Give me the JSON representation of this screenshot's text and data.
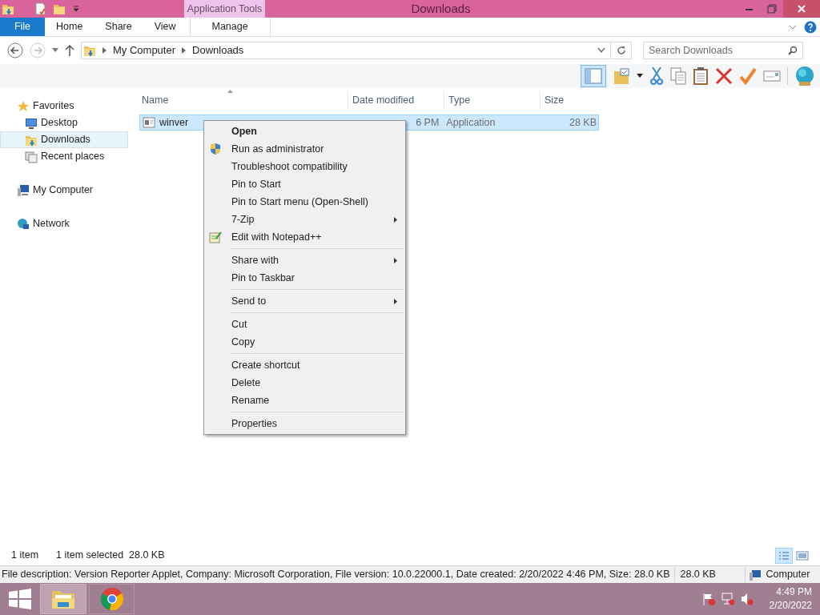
{
  "window": {
    "title": "Downloads"
  },
  "ribbon": {
    "file_tab": "File",
    "tabs": [
      "Home",
      "Share",
      "View"
    ],
    "context_group": {
      "title": "Application Tools",
      "tabs": [
        "Manage"
      ]
    }
  },
  "address_bar": {
    "path": [
      "My Computer",
      "Downloads"
    ]
  },
  "search": {
    "placeholder": "Search Downloads"
  },
  "sidebar": {
    "items": [
      {
        "label": "Favorites",
        "selected": false,
        "children": [
          {
            "label": "Desktop",
            "selected": false
          },
          {
            "label": "Downloads",
            "selected": true
          },
          {
            "label": "Recent places",
            "selected": false
          }
        ]
      },
      {
        "label": "My Computer",
        "selected": false
      },
      {
        "label": "Network",
        "selected": false
      }
    ]
  },
  "table": {
    "columns": [
      "Name",
      "Date modified",
      "Type",
      "Size"
    ],
    "rows": [
      {
        "name": "winver",
        "date_modified": "6 PM",
        "type": "Application",
        "size": "28 KB",
        "selected": true
      }
    ]
  },
  "context_menu": {
    "groups": [
      [
        {
          "label": "Open",
          "default": true,
          "submenu": false
        },
        {
          "label": "Run as administrator",
          "default": false,
          "submenu": false
        },
        {
          "label": "Troubleshoot compatibility",
          "default": false,
          "submenu": false
        },
        {
          "label": "Pin to Start",
          "default": false,
          "submenu": false
        },
        {
          "label": "Pin to Start menu (Open-Shell)",
          "default": false,
          "submenu": false
        },
        {
          "label": "7-Zip",
          "default": false,
          "submenu": true
        },
        {
          "label": "Edit with Notepad++",
          "default": false,
          "submenu": false
        }
      ],
      [
        {
          "label": "Share with",
          "default": false,
          "submenu": true
        },
        {
          "label": "Pin to Taskbar",
          "default": false,
          "submenu": false
        }
      ],
      [
        {
          "label": "Send to",
          "default": false,
          "submenu": true
        }
      ],
      [
        {
          "label": "Cut",
          "default": false,
          "submenu": false
        },
        {
          "label": "Copy",
          "default": false,
          "submenu": false
        }
      ],
      [
        {
          "label": "Create shortcut",
          "default": false,
          "submenu": false
        },
        {
          "label": "Delete",
          "default": false,
          "submenu": false
        },
        {
          "label": "Rename",
          "default": false,
          "submenu": false
        }
      ],
      [
        {
          "label": "Properties",
          "default": false,
          "submenu": false
        }
      ]
    ]
  },
  "status_bar": {
    "item_count": "1 item",
    "selection": "1 item selected  28.0 KB"
  },
  "details_bar": {
    "description": "File description: Version Reporter Applet, Company: Microsoft Corporation, File version: 10.0.22000.1, Date created: 2/20/2022 4:46 PM, Size: 28.0 KB",
    "size": "28.0 KB",
    "location": "Computer"
  },
  "taskbar": {
    "time": "4:49 PM",
    "date": "2/20/2022"
  }
}
